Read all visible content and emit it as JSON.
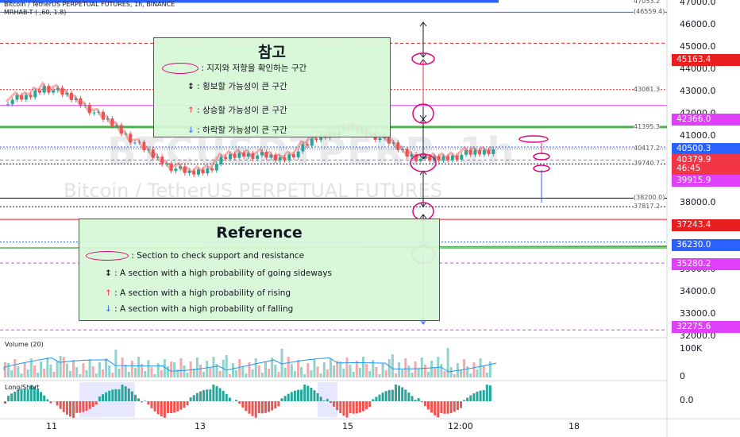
{
  "header": {
    "title": "Bitcoin / TetherUS PERPETUAL FUTURES, 1h, BINANCE",
    "indicator": "MRHAB-T ( ,60, 1.8)"
  },
  "watermark": {
    "symbol": "BTCUSDTPERP, 1h",
    "name": "Bitcoin / TetherUS PERPETUAL FUTURES"
  },
  "legend_ko": {
    "title": "참고",
    "items": [
      ": 지지와 저항을 확인하는 구간",
      ": 횡보할 가능성이 큰 구간",
      ": 상승할 가능성이 큰 구간",
      ": 하락할 가능성이 큰 구간"
    ]
  },
  "legend_en": {
    "title": "Reference",
    "items": [
      ": Section to check support and resistance",
      ": A section with a high probability of going sideways",
      ": A section with a high probability of rising",
      ": A section with a high probability of falling"
    ]
  },
  "price_labels": [
    {
      "text": "45163.4",
      "color": "#e91e1e"
    },
    {
      "text": "42366.0",
      "color": "#e040fb"
    },
    {
      "text": "40500.3",
      "color": "#2962ff"
    },
    {
      "text": "40379.9",
      "color": "#f23645"
    },
    {
      "text": "46:45",
      "color": "#f23645"
    },
    {
      "text": "39915.9",
      "color": "#e040fb"
    },
    {
      "text": "37243.4",
      "color": "#e91e1e"
    },
    {
      "text": "36230.0",
      "color": "#2962ff"
    },
    {
      "text": "35280.2",
      "color": "#e040fb"
    },
    {
      "text": "32275.6",
      "color": "#e040fb"
    }
  ],
  "hline_labels": [
    "47053.2",
    "(46559.4)",
    "43081.3",
    "41395.3",
    "40417.2",
    "39740.7",
    "(38200.0)",
    "37817.2"
  ],
  "axis": {
    "ticks": [
      "47000.0",
      "46000.0",
      "45000.0",
      "44000.0",
      "43000.0",
      "42000.0",
      "41000.0",
      "40000.0",
      "39000.0",
      "38000.0",
      "37000.0",
      "36000.0",
      "35000.0",
      "34000.0",
      "33000.0",
      "32000.0"
    ],
    "vol_ticks": [
      "100K",
      "0"
    ],
    "ls_tick": "0.0"
  },
  "time_labels": [
    "11",
    "13",
    "15",
    "12:00",
    "18"
  ],
  "panels": {
    "volume": "Volume (20)",
    "longshort": "Long/Short"
  },
  "chart_data": {
    "type": "line",
    "title": "Bitcoin / TetherUS PERPETUAL FUTURES, 1h, BINANCE",
    "x": [
      "11",
      "13",
      "15",
      "12:00",
      "18"
    ],
    "ylim": [
      31800,
      47700
    ],
    "series": [
      {
        "values": [
          42600,
          42700,
          43200,
          42900,
          42500,
          41900,
          41400,
          40700,
          40100,
          39600,
          39300,
          39500,
          40000,
          40200,
          40100,
          39950,
          40300,
          40900,
          41200,
          41350,
          41100,
          40700,
          40200,
          39900,
          40000,
          40150,
          40250,
          40380
        ]
      }
    ],
    "levels": [
      47053.2,
      46559.4,
      45163.4,
      43081.3,
      42366.0,
      41395.3,
      40500.3,
      40417.2,
      39915.9,
      39740.7,
      38200.0,
      37817.2,
      37243.4,
      36230.0,
      35280.2,
      32275.6
    ]
  }
}
